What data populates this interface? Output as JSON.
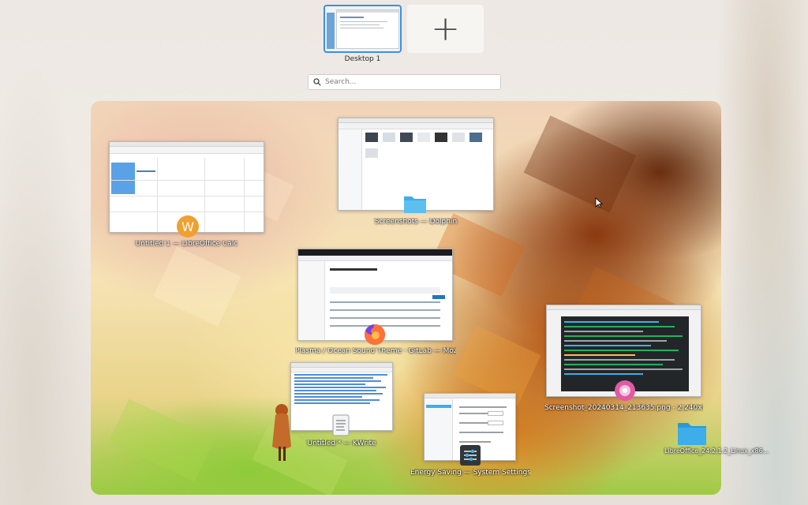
{
  "desktops": [
    {
      "label": "Desktop 1",
      "active": true
    }
  ],
  "add_desktop_symbol": "+",
  "search": {
    "placeholder": "Search..."
  },
  "windows": [
    {
      "caption": "Untitled 1 — LibreOffice Calc",
      "icon": "libreoffice-calc-icon"
    },
    {
      "caption": "Screenshots — Dolphin",
      "icon": "folder-icon"
    },
    {
      "caption": "Plasma / Ocean Sound Theme · GitLab — Mozi...",
      "icon": "firefox-icon"
    },
    {
      "caption": "Screenshot_20240314_213635.png - 2,240x1,...",
      "icon": "image-viewer-icon"
    },
    {
      "caption": "Untitled * — KWrite",
      "icon": "kwrite-icon"
    },
    {
      "caption": "Energy Saving — System Settings",
      "icon": "system-settings-icon"
    }
  ],
  "desktop_folder": {
    "label": "LibreOffice_24.2.1.2_Linux_x86...",
    "icon": "folder-icon"
  },
  "colors": {
    "accent": "#3d8fe0",
    "folder": "#3daee9",
    "calc_badge": "#f0a030"
  }
}
